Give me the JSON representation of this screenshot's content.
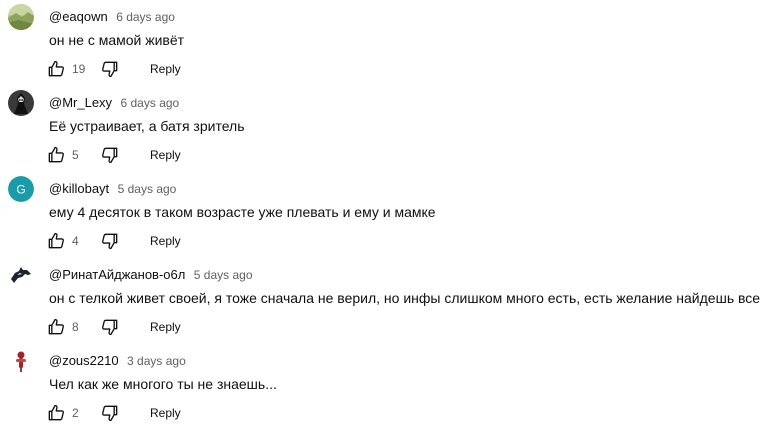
{
  "comments": [
    {
      "author": "@eaqown",
      "time": "6 days ago",
      "text": "он не с мамой живёт",
      "likes": "19",
      "reply_label": "Reply",
      "avatar": {
        "icon": "landscape-photo-avatar",
        "color": "#8ea35a"
      }
    },
    {
      "author": "@Mr_Lexy",
      "time": "6 days ago",
      "text": "Её устраивает, а батя зритель",
      "likes": "5",
      "reply_label": "Reply",
      "avatar": {
        "icon": "dark-character-avatar",
        "color": "#2a2a2a"
      }
    },
    {
      "author": "@killobayt",
      "time": "5 days ago",
      "text": "ему 4 десяток в таком возрасте уже плевать и ему и мамке",
      "likes": "4",
      "reply_label": "Reply",
      "avatar": {
        "icon": "letter-avatar",
        "letter": "G",
        "color": "#1b9aa8"
      }
    },
    {
      "author": "@РинатАйджанов-о6л",
      "time": "5 days ago",
      "text": "он с телкой живет своей, я тоже сначала не верил, но инфы слишком много есть, есть желание найдешь все",
      "likes": "8",
      "reply_label": "Reply",
      "avatar": {
        "icon": "horse-logo-avatar",
        "color": "#1a2433"
      }
    },
    {
      "author": "@zous2210",
      "time": "3 days ago",
      "text": "Чел как же многого ты не знаешь...",
      "likes": "2",
      "reply_label": "Reply",
      "avatar": {
        "icon": "small-character-avatar",
        "color": "#a32424"
      }
    }
  ]
}
